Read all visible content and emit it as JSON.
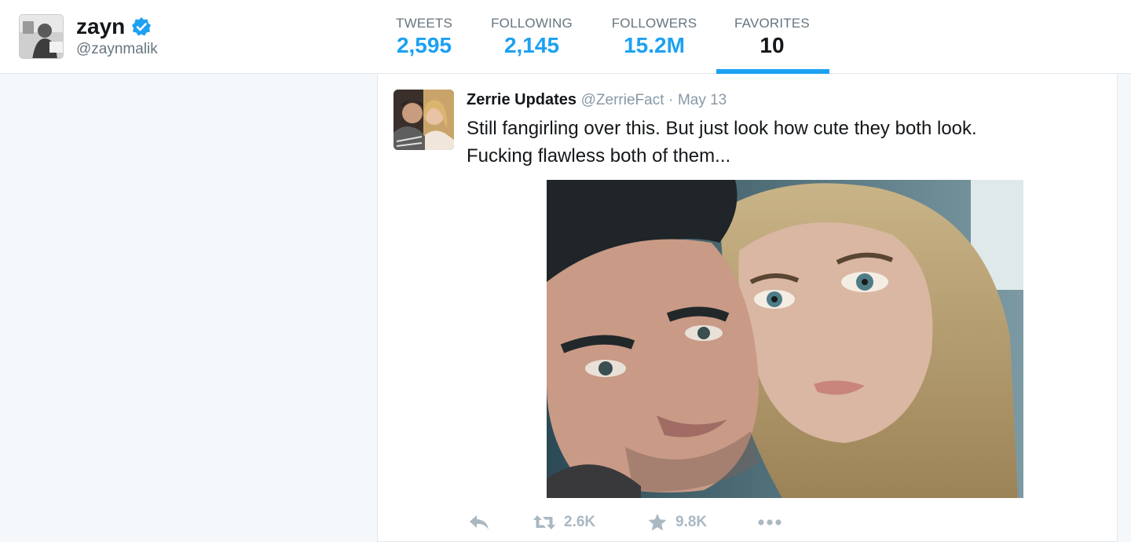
{
  "profile": {
    "name": "zayn",
    "handle": "@zaynmalik",
    "verified": true
  },
  "stats": [
    {
      "label": "TWEETS",
      "value": "2,595",
      "active": false
    },
    {
      "label": "FOLLOWING",
      "value": "2,145",
      "active": false
    },
    {
      "label": "FOLLOWERS",
      "value": "15.2M",
      "active": false
    },
    {
      "label": "FAVORITES",
      "value": "10",
      "active": true
    }
  ],
  "tweet": {
    "author_name": "Zerrie Updates",
    "author_handle": "@ZerrieFact",
    "separator": "·",
    "date": "May 13",
    "text_lines": [
      "Still fangirling over this. But just look how cute they both look.",
      "Fucking flawless both of them..."
    ],
    "actions": {
      "reply_icon": "reply-icon",
      "retweet_icon": "retweet-icon",
      "retweet_count": "2.6K",
      "favorite_icon": "star-icon",
      "favorite_count": "9.8K",
      "more_icon": "more-icon"
    }
  },
  "colors": {
    "accent": "#1da1f2",
    "muted": "#8899a6",
    "action_gray": "#aab8c2",
    "verified": "#1da1f2"
  }
}
